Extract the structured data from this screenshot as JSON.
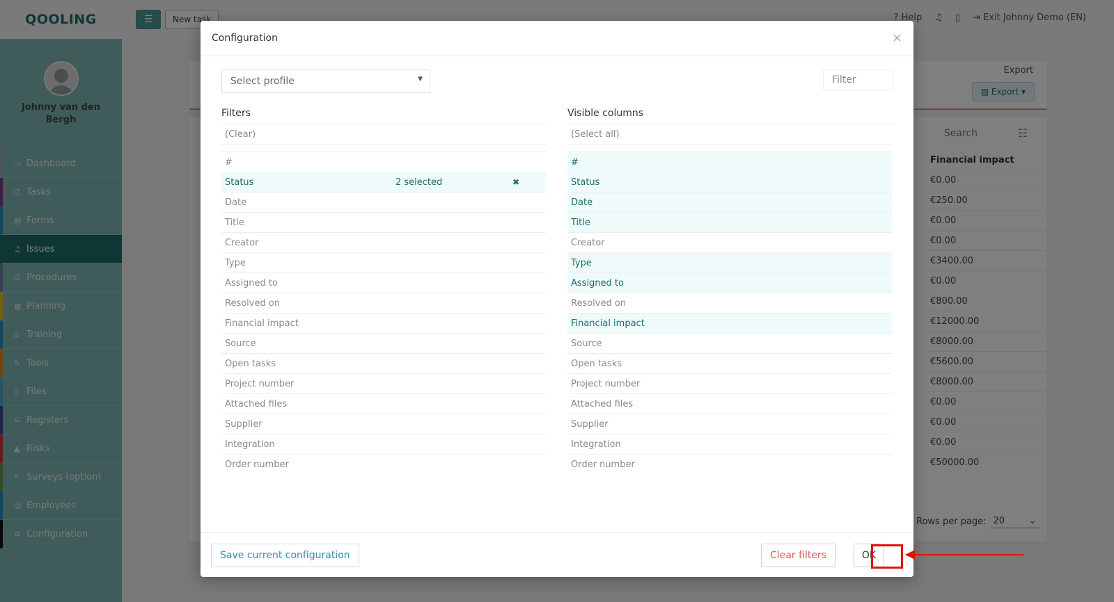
{
  "logo": "QOOLING",
  "user": {
    "name": "Johnny van den Bergh"
  },
  "nav": [
    {
      "label": "Dashboard",
      "icon": "monitor-icon",
      "glyph": "▭",
      "accent": "#9aa9b7",
      "active": false
    },
    {
      "label": "Tasks",
      "icon": "checkbox-icon",
      "glyph": "☑",
      "accent": "#7d3b8f",
      "active": false
    },
    {
      "label": "Forms",
      "icon": "document-icon",
      "glyph": "▤",
      "accent": "#2b8fc8",
      "active": false
    },
    {
      "label": "Issues",
      "icon": "bell-icon",
      "glyph": "♫",
      "accent": "#1c6d6a",
      "active": true
    },
    {
      "label": "Procedures",
      "icon": "list-icon",
      "glyph": "☰",
      "accent": "#6b7fb0",
      "active": false
    },
    {
      "label": "Planning",
      "icon": "calendar-icon",
      "glyph": "▦",
      "accent": "#e5c22b",
      "active": false
    },
    {
      "label": "Training",
      "icon": "graduation-cap-icon",
      "glyph": "⌂",
      "accent": "#2b8fc8",
      "active": false
    },
    {
      "label": "Tools",
      "icon": "wrench-icon",
      "glyph": "✎",
      "accent": "#e08a2b",
      "active": false
    },
    {
      "label": "Files",
      "icon": "file-icon",
      "glyph": "▯",
      "accent": "#4aa8c8",
      "active": false
    },
    {
      "label": "Registers",
      "icon": "registers-icon",
      "glyph": "≡",
      "accent": "#3b4a9a",
      "active": false
    },
    {
      "label": "Risks",
      "icon": "warning-icon",
      "glyph": "▲",
      "accent": "#c83b3b",
      "active": false
    },
    {
      "label": "Surveys (option)",
      "icon": "comments-icon",
      "glyph": "❝",
      "accent": "#6b9a3b",
      "active": false
    },
    {
      "label": "Employees",
      "icon": "users-icon",
      "glyph": "☺",
      "accent": "#2b8fc8",
      "active": false
    },
    {
      "label": "Configuration",
      "icon": "gear-icon",
      "glyph": "⚙",
      "accent": "#111111",
      "active": false
    }
  ],
  "topbar": {
    "new_task": "New task",
    "help": "Help",
    "exit": "Exit Johnny Demo (EN)"
  },
  "page": {
    "export_label": "Export",
    "export_button": "Export",
    "search": "Search",
    "financial_header": "Financial impact",
    "financial_values": [
      "€0.00",
      "€250.00",
      "€0.00",
      "€0.00",
      "€3400.00",
      "€0.00",
      "€800.00",
      "€12000.00",
      "€8000.00",
      "€5600.00",
      "€8000.00",
      "€0.00",
      "€0.00",
      "€0.00",
      "€50000.00"
    ],
    "rows_per_page_label": "Rows per page:",
    "rows_per_page_value": "20"
  },
  "modal": {
    "title": "Configuration",
    "profile_placeholder": "Select profile",
    "filter_placeholder": "Filter",
    "filters_title": "Filters",
    "filters_clear": "(Clear)",
    "columns_title": "Visible columns",
    "columns_select_all": "(Select all)",
    "fields": [
      {
        "label": "#",
        "filter_count": "",
        "visible": true
      },
      {
        "label": "Status",
        "filter_count": "2 selected",
        "visible": true
      },
      {
        "label": "Date",
        "filter_count": "",
        "visible": true
      },
      {
        "label": "Title",
        "filter_count": "",
        "visible": true
      },
      {
        "label": "Creator",
        "filter_count": "",
        "visible": false
      },
      {
        "label": "Type",
        "filter_count": "",
        "visible": true
      },
      {
        "label": "Assigned to",
        "filter_count": "",
        "visible": true
      },
      {
        "label": "Resolved on",
        "filter_count": "",
        "visible": false
      },
      {
        "label": "Financial impact",
        "filter_count": "",
        "visible": true
      },
      {
        "label": "Source",
        "filter_count": "",
        "visible": false
      },
      {
        "label": "Open tasks",
        "filter_count": "",
        "visible": false
      },
      {
        "label": "Project number",
        "filter_count": "",
        "visible": false
      },
      {
        "label": "Attached files",
        "filter_count": "",
        "visible": false
      },
      {
        "label": "Supplier",
        "filter_count": "",
        "visible": false
      },
      {
        "label": "Integration",
        "filter_count": "",
        "visible": false
      },
      {
        "label": "Order number",
        "filter_count": "",
        "visible": false
      }
    ],
    "save_button": "Save current configuration",
    "clear_filters_button": "Clear filters",
    "ok_button": "OK"
  }
}
